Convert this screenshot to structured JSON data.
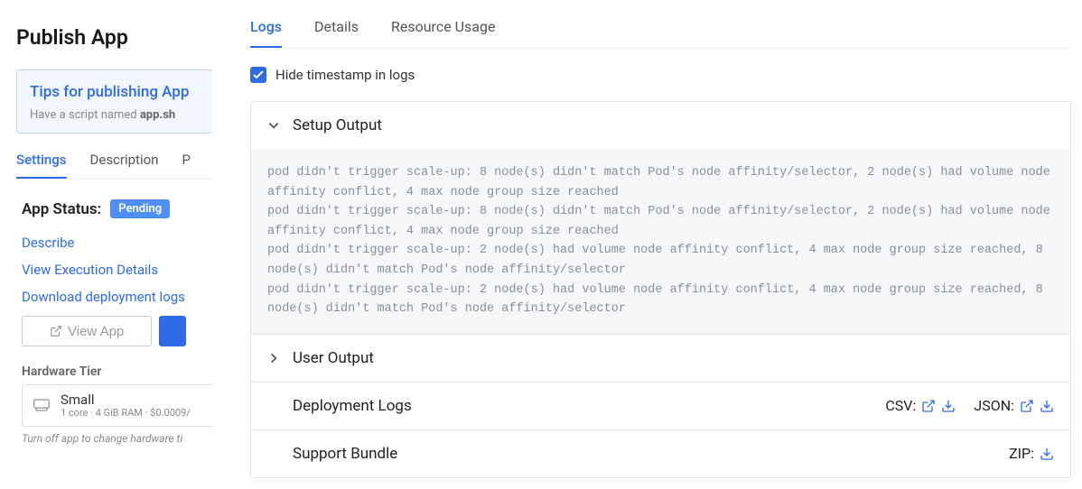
{
  "sidebar": {
    "title": "Publish App",
    "tips": {
      "title": "Tips for publishing App",
      "body_prefix": "Have a script named ",
      "body_strong": "app.sh"
    },
    "tabs": [
      "Settings",
      "Description",
      "P"
    ],
    "active_tab": 0,
    "status": {
      "label": "App Status:",
      "badge": "Pending"
    },
    "links": [
      "Describe",
      "View Execution Details",
      "Download deployment logs"
    ],
    "view_app_btn": "View App",
    "hardware": {
      "label": "Hardware Tier",
      "name": "Small",
      "spec": "1 core · 4 GiB RAM · $0.0009/",
      "note": "Turn off app to change hardware ti"
    }
  },
  "main": {
    "tabs": [
      "Logs",
      "Details",
      "Resource Usage"
    ],
    "active_tab": 0,
    "hide_timestamp_label": "Hide timestamp in logs",
    "hide_timestamp_checked": true,
    "sections": {
      "setup": {
        "title": "Setup Output",
        "expanded": true,
        "log": "pod didn't trigger scale-up: 8 node(s) didn't match Pod's node affinity/selector, 2 node(s) had volume node affinity conflict, 4 max node group size reached\npod didn't trigger scale-up: 8 node(s) didn't match Pod's node affinity/selector, 2 node(s) had volume node affinity conflict, 4 max node group size reached\npod didn't trigger scale-up: 2 node(s) had volume node affinity conflict, 4 max node group size reached, 8 node(s) didn't match Pod's node affinity/selector\npod didn't trigger scale-up: 2 node(s) had volume node affinity conflict, 4 max node group size reached, 8 node(s) didn't match Pod's node affinity/selector"
      },
      "user": {
        "title": "User Output",
        "expanded": false
      },
      "deployment": {
        "title": "Deployment Logs",
        "csv_label": "CSV:",
        "json_label": "JSON:"
      },
      "support": {
        "title": "Support Bundle",
        "zip_label": "ZIP:"
      }
    }
  }
}
